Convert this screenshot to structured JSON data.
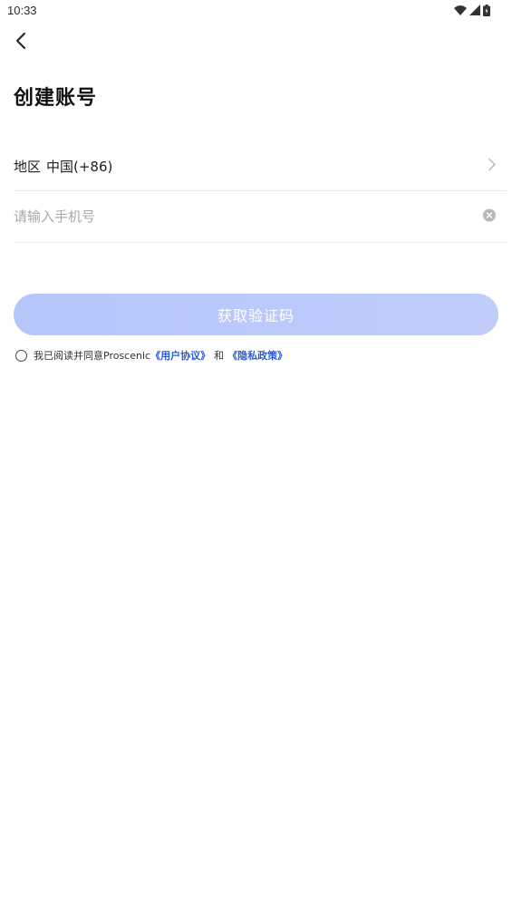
{
  "status_bar": {
    "time": "10:33",
    "icons": [
      "wifi-icon",
      "signal-icon",
      "battery-icon"
    ]
  },
  "header": {
    "back_icon": "chevron-left-icon"
  },
  "page": {
    "title": "创建账号"
  },
  "region": {
    "label": "地区",
    "value": "中国(+86)",
    "chevron_icon": "chevron-right-icon"
  },
  "phone": {
    "placeholder": "请输入手机号",
    "value": "",
    "clear_icon": "clear-icon"
  },
  "get_code_button": {
    "label": "获取验证码",
    "color": "#b6c6fb"
  },
  "agreement": {
    "prefix": "我已阅读并同意Proscenic",
    "user_agreement": "《用户协议》",
    "conjunction": "和",
    "privacy_policy": "《隐私政策》",
    "link_color": "#2a5bd7"
  }
}
